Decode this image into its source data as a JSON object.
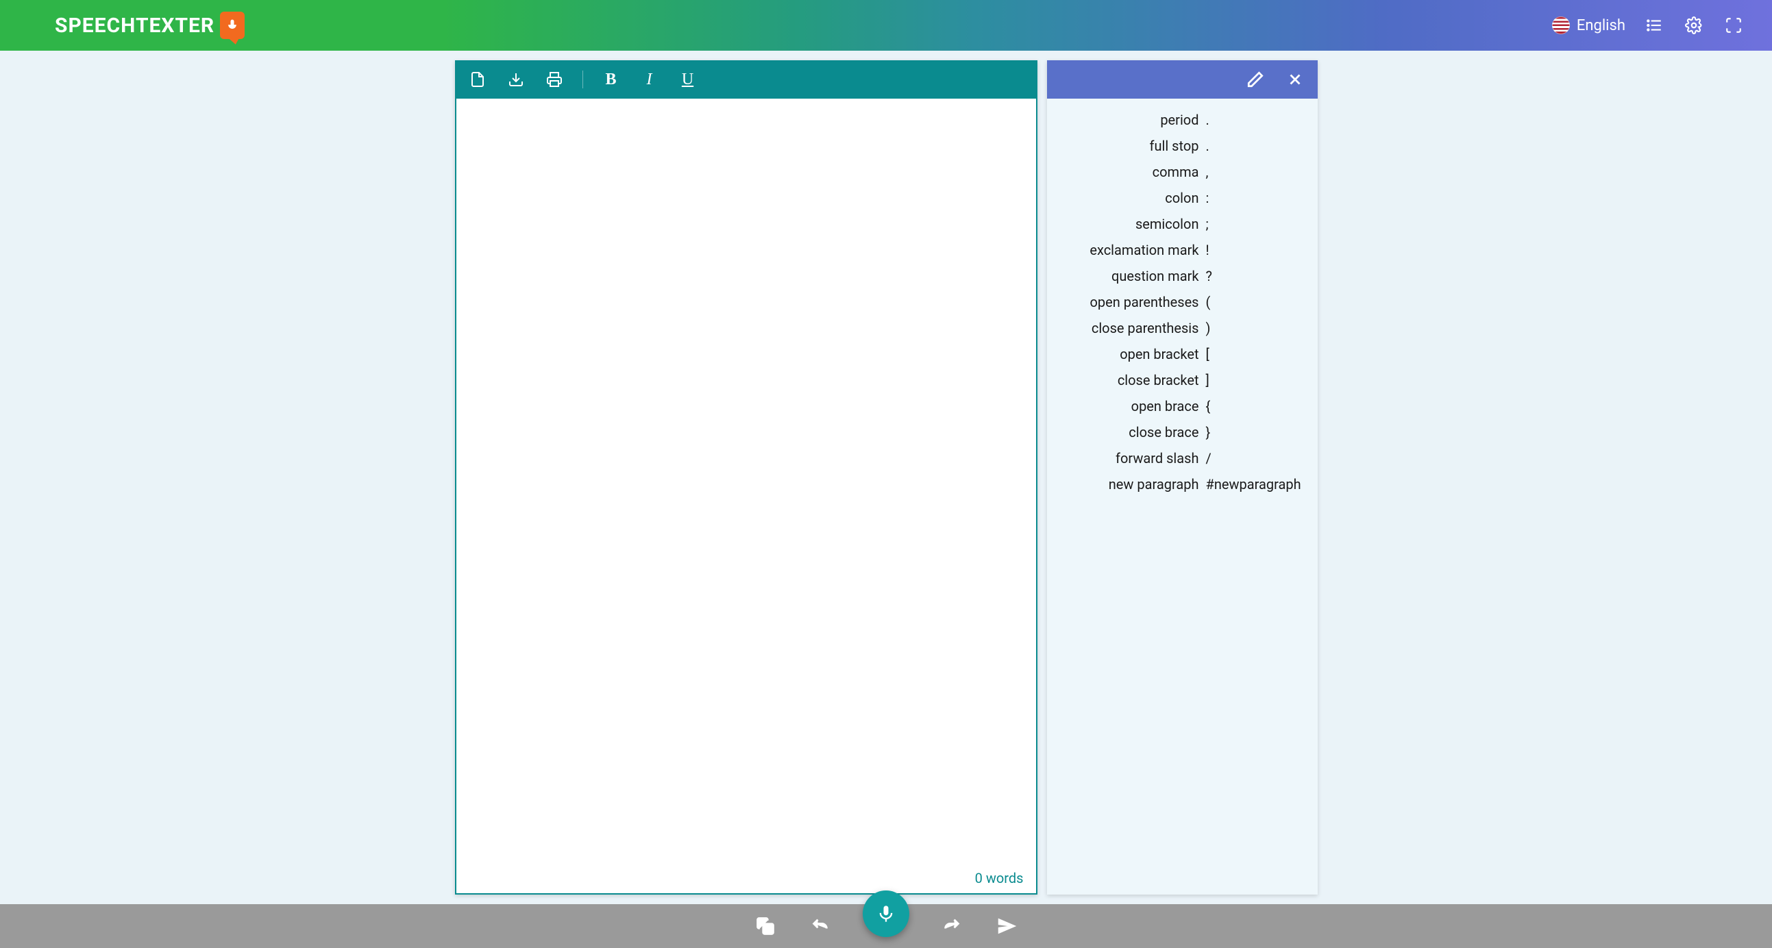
{
  "header": {
    "logo_text": "SPEECHTEXTER",
    "language_label": "English"
  },
  "editor": {
    "word_count": "0 words"
  },
  "commands": [
    {
      "name": "period",
      "symbol": "."
    },
    {
      "name": "full stop",
      "symbol": "."
    },
    {
      "name": "comma",
      "symbol": ","
    },
    {
      "name": "colon",
      "symbol": ":"
    },
    {
      "name": "semicolon",
      "symbol": ";"
    },
    {
      "name": "exclamation mark",
      "symbol": "!"
    },
    {
      "name": "question mark",
      "symbol": "?"
    },
    {
      "name": "open parentheses",
      "symbol": "("
    },
    {
      "name": "close parenthesis",
      "symbol": ")"
    },
    {
      "name": "open bracket",
      "symbol": "["
    },
    {
      "name": "close bracket",
      "symbol": "]"
    },
    {
      "name": "open brace",
      "symbol": "{"
    },
    {
      "name": "close brace",
      "symbol": "}"
    },
    {
      "name": "forward slash",
      "symbol": "/"
    },
    {
      "name": "new paragraph",
      "symbol": "#newparagraph"
    }
  ]
}
